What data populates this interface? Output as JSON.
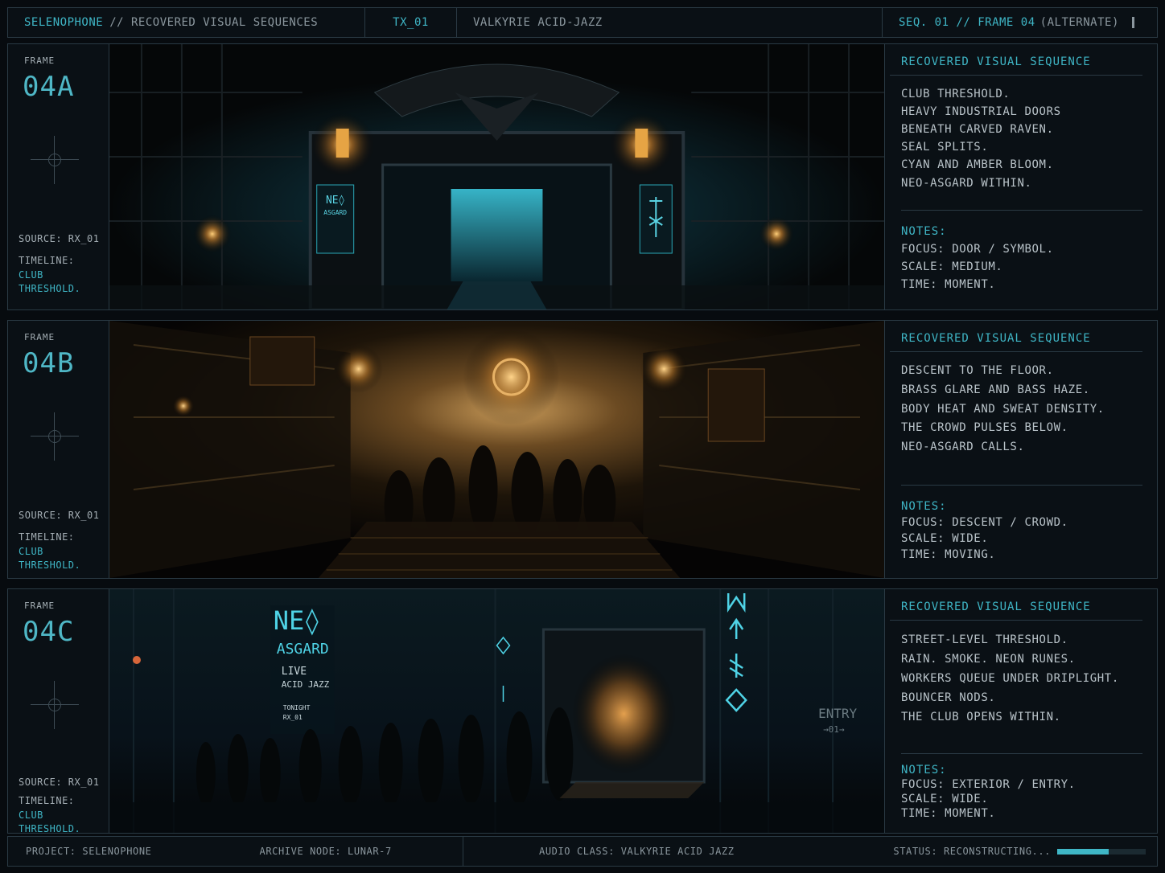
{
  "header": {
    "app": "SELENOPHONE",
    "section": "// RECOVERED VISUAL SEQUENCES",
    "tx": "TX_01",
    "track": "VALKYRIE ACID-JAZZ",
    "seq": "SEQ. 01 // FRAME 04",
    "seq_alt": "(ALTERNATE)"
  },
  "frames": [
    {
      "label": "FRAME",
      "id": "04A",
      "source": "SOURCE: RX_01",
      "timeline_label": "TIMELINE:",
      "timeline_value": "CLUB THRESHOLD.",
      "title": "RECOVERED VISUAL SEQUENCE",
      "desc": [
        "CLUB THRESHOLD.",
        "HEAVY INDUSTRIAL DOORS",
        "BENEATH CARVED RAVEN.",
        "SEAL SPLITS.",
        "CYAN AND AMBER BLOOM.",
        "NEO-ASGARD WITHIN."
      ],
      "notes_label": "NOTES:",
      "notes": [
        "FOCUS: DOOR / SYMBOL.",
        "SCALE: MEDIUM.",
        "TIME: MOMENT."
      ]
    },
    {
      "label": "FRAME",
      "id": "04B",
      "source": "SOURCE: RX_01",
      "timeline_label": "TIMELINE:",
      "timeline_value": "CLUB THRESHOLD.",
      "title": "RECOVERED VISUAL SEQUENCE",
      "desc": [
        "DESCENT TO THE FLOOR.",
        "BRASS GLARE AND BASS HAZE.",
        "BODY HEAT AND SWEAT DENSITY.",
        "THE CROWD PULSES BELOW.",
        "NEO-ASGARD CALLS."
      ],
      "notes_label": "NOTES:",
      "notes": [
        "FOCUS: DESCENT / CROWD.",
        "SCALE: WIDE.",
        "TIME: MOVING."
      ]
    },
    {
      "label": "FRAME",
      "id": "04C",
      "source": "SOURCE: RX_01",
      "timeline_label": "TIMELINE:",
      "timeline_value": "CLUB THRESHOLD.",
      "title": "RECOVERED VISUAL SEQUENCE",
      "desc": [
        "STREET-LEVEL THRESHOLD.",
        "RAIN. SMOKE. NEON RUNES.",
        "WORKERS QUEUE UNDER DRIPLIGHT.",
        "BOUNCER NODS.",
        "THE CLUB OPENS WITHIN."
      ],
      "notes_label": "NOTES:",
      "notes": [
        "FOCUS: EXTERIOR / ENTRY.",
        "SCALE: WIDE.",
        "TIME: MOMENT."
      ]
    }
  ],
  "signage": {
    "neo": "NE◊",
    "asgard": "ASGARD",
    "live": "LIVE",
    "acid": "ACID JAZZ",
    "tonight": "TONIGHT",
    "rx": "RX_01",
    "entry": "ENTRY",
    "entry_sub": "→01→"
  },
  "footer": {
    "project": "PROJECT: SELENOPHONE",
    "node": "ARCHIVE NODE: LUNAR-7",
    "audio": "AUDIO CLASS: VALKYRIE ACID JAZZ",
    "status": "STATUS: RECONSTRUCTING...",
    "progress": 0.58
  },
  "colors": {
    "accent": "#3fb6c6",
    "amber": "#e0a04a",
    "border": "#2a3a44"
  }
}
